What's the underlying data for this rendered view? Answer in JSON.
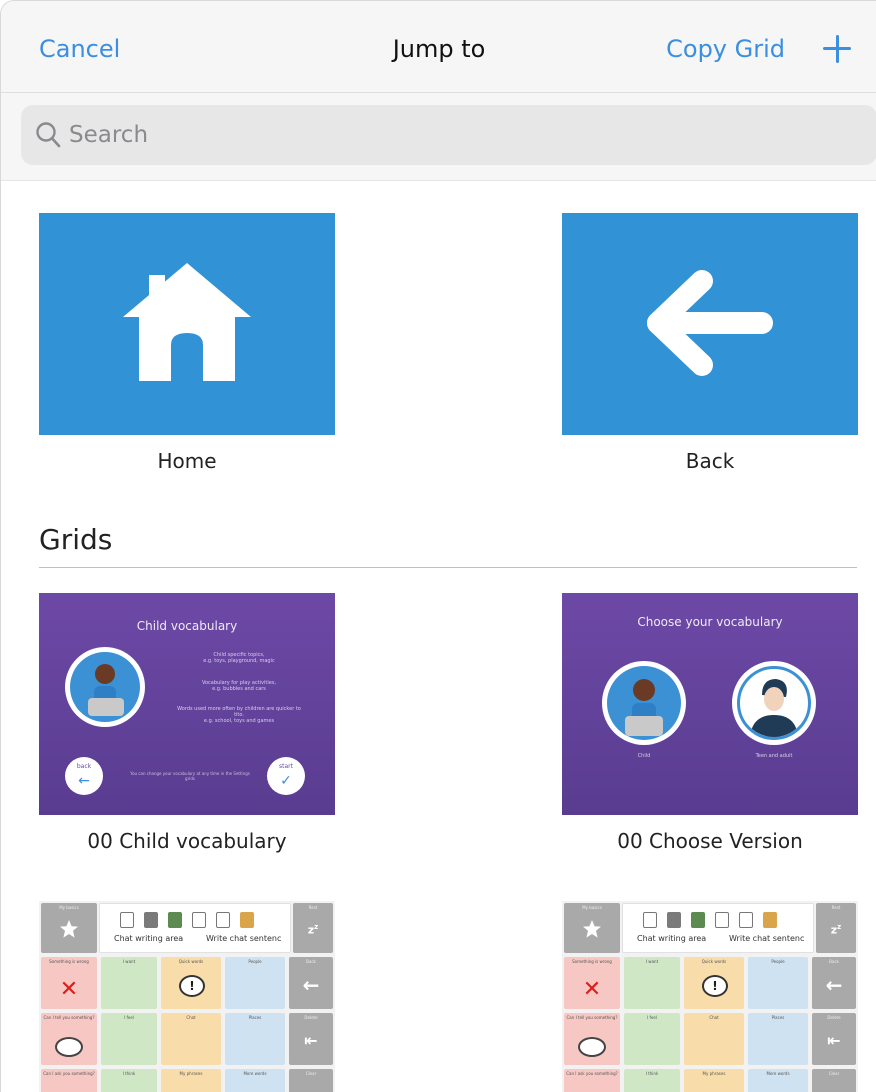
{
  "nav": {
    "cancel": "Cancel",
    "title": "Jump to",
    "copy_grid": "Copy Grid",
    "add_icon": "plus-icon"
  },
  "search": {
    "placeholder": "Search",
    "icon": "search-icon"
  },
  "quick_links": [
    {
      "label": "Home",
      "icon": "home-icon",
      "color": "#3292d6"
    },
    {
      "label": "Back",
      "icon": "arrow-left-icon",
      "color": "#3292d6"
    }
  ],
  "grids_section": {
    "title": "Grids",
    "items": [
      {
        "label": "00 Child vocabulary",
        "thumb": {
          "title": "Child vocabulary",
          "lines": [
            "Child specific topics,",
            "e.g. toys, playground, magic",
            "Vocabulary for play activities,",
            "e.g. bubbles and cars",
            "Words used more often by children are quicker to",
            "tito.",
            "e.g. school, toys and games"
          ],
          "back_label": "back",
          "start_label": "start",
          "footer": "You can change your vocabulary at any time in the Settings grids"
        }
      },
      {
        "label": "00 Choose Version",
        "thumb": {
          "title": "Choose your vocabulary",
          "option_child": "Child",
          "option_adult": "Teen and adult"
        }
      },
      {
        "label": "",
        "thumb": {
          "top_left": "My basics",
          "chat_label": "Chat writing area",
          "write_label": "Write chat sentenc",
          "top_right": "Rest",
          "rows": [
            [
              "Something is wrong",
              "I want",
              "Quick words",
              "People",
              "Back"
            ],
            [
              "Can I tell you something?",
              "I feel",
              "Chat",
              "Places",
              "Delete"
            ],
            [
              "Can I ask you something?",
              "I think",
              "My phrases",
              "More words",
              "Clear"
            ]
          ]
        }
      },
      {
        "label": "",
        "thumb": {
          "top_left": "My basics",
          "chat_label": "Chat writing area",
          "write_label": "Write chat sentenc",
          "top_right": "Rest",
          "rows": [
            [
              "Something is wrong",
              "I want",
              "Quick words",
              "People",
              "Back"
            ],
            [
              "Can I tell you something?",
              "I feel",
              "Chat",
              "Places",
              "Delete"
            ],
            [
              "Can I ask you something?",
              "I think",
              "My phrases",
              "More words",
              "Clear"
            ]
          ]
        }
      }
    ]
  }
}
